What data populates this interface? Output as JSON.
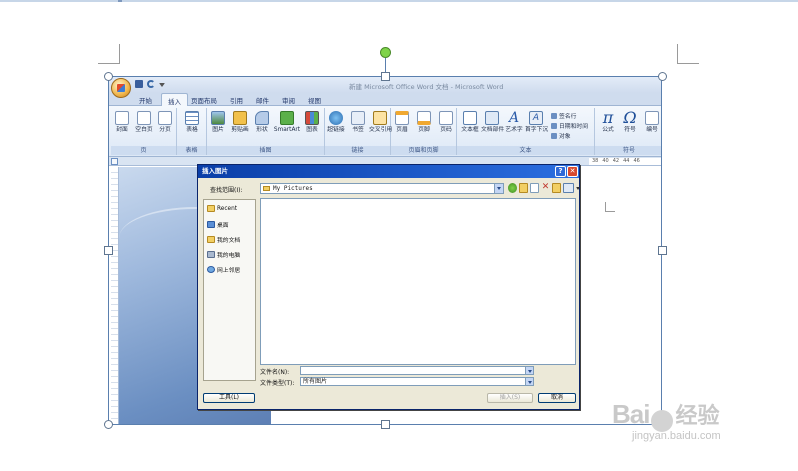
{
  "word": {
    "window_title": "新建 Microsoft Office Word 文档 - Microsoft Word",
    "tabs": [
      "开始",
      "插入",
      "页面布局",
      "引用",
      "邮件",
      "审阅",
      "视图"
    ],
    "active_tab": "插入",
    "groups": {
      "pages": {
        "label": "页",
        "buttons": [
          "封面",
          "空白页",
          "分页"
        ]
      },
      "tables": {
        "label": "表格",
        "buttons": [
          "表格"
        ]
      },
      "illustrations": {
        "label": "插图",
        "buttons": [
          "图片",
          "剪贴画",
          "形状",
          "SmartArt",
          "图表"
        ]
      },
      "links": {
        "label": "链接",
        "buttons": [
          "超链接",
          "书签",
          "交叉引用"
        ]
      },
      "header_footer": {
        "label": "页眉和页脚",
        "buttons": [
          "页眉",
          "页脚",
          "页码"
        ]
      },
      "text": {
        "label": "文本",
        "buttons": [
          "文本框",
          "文档部件",
          "艺术字",
          "首字下沉"
        ],
        "small": [
          "签名行",
          "日期和时间",
          "对象"
        ]
      },
      "symbols": {
        "label": "符号",
        "buttons": [
          "公式",
          "符号",
          "编号"
        ],
        "icons": [
          "π",
          "Ω"
        ]
      }
    },
    "ruler_ticks": [
      "38",
      "40",
      "42",
      "44",
      "46"
    ]
  },
  "dialog": {
    "title": "插入图片",
    "help_glyph": "?",
    "close_glyph": "✕",
    "look_in_label": "查找范围(I):",
    "look_in_value": "My Pictures",
    "places": [
      "Recent",
      "桌面",
      "我的文档",
      "我的电脑",
      "网上邻居"
    ],
    "file_name_label": "文件名(N):",
    "file_name_value": "",
    "file_type_label": "文件类型(T):",
    "file_type_value": "所有图片",
    "tools_button": "工具(L)",
    "insert_button": "插入(S)",
    "cancel_button": "取消"
  },
  "watermark": {
    "logo_left": "Bai",
    "logo_right": "经验",
    "url": "jingyan.baidu.com"
  },
  "colors": {
    "selection_border": "#5a7fae",
    "rotate_handle": "#7fd34a",
    "dialog_title": "#0a3ea8"
  }
}
